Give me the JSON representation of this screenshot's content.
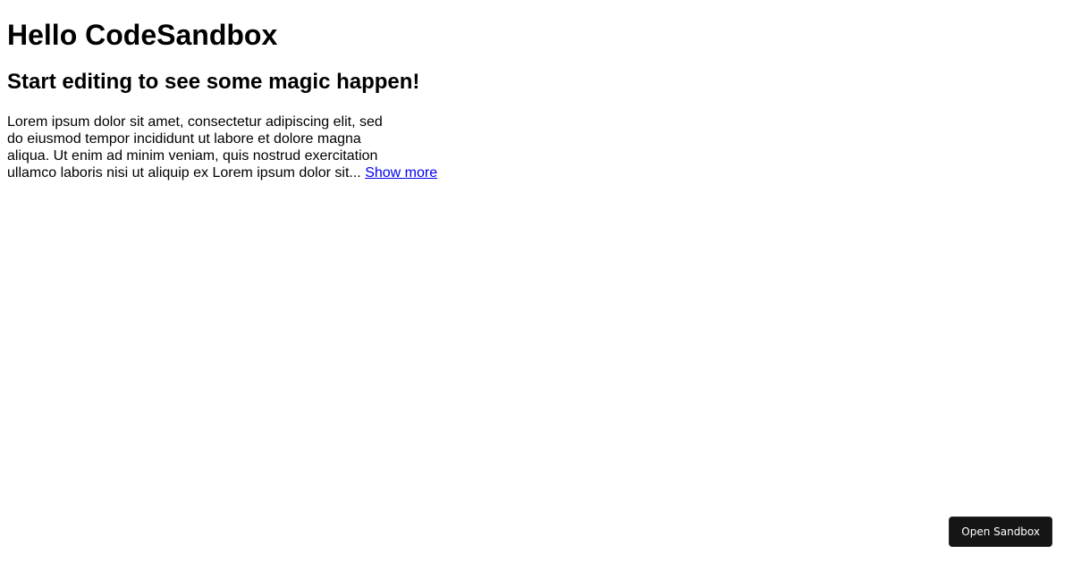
{
  "page": {
    "title": "Hello CodeSandbox",
    "subtitle": "Start editing to see some magic happen!",
    "paragraph_lines": [
      "Lorem ipsum dolor sit amet, consectetur adipiscing elit, sed",
      "do eiusmod tempor incididunt ut labore et dolore magna",
      "aliqua. Ut enim ad minim veniam, quis nostrud exercitation",
      "ullamco laboris nisi ut aliquip ex Lorem ipsum dolor sit..."
    ],
    "show_more_label": "Show more"
  },
  "sandbox": {
    "open_label": "Open Sandbox"
  },
  "colors": {
    "link": "#0000ee",
    "button_bg": "#151515",
    "button_text": "#ffffff"
  }
}
